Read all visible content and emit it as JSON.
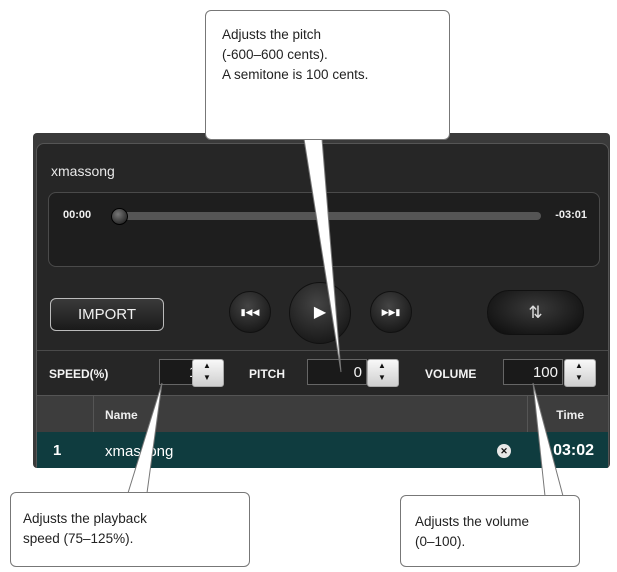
{
  "player": {
    "song_title": "xmassong",
    "time_elapsed": "00:00",
    "time_remaining": "-03:01",
    "progress": 0.0,
    "import_label": "IMPORT",
    "prev_icon": "skip-previous-icon",
    "play_icon": "play-icon",
    "next_icon": "skip-next-icon",
    "loop_icon": "repeat-icon"
  },
  "controls": {
    "speed_label": "SPEED(%)",
    "speed_value": "100",
    "pitch_label": "PITCH",
    "pitch_value": "0",
    "volume_label": "VOLUME",
    "volume_value": "100"
  },
  "list": {
    "headers": {
      "name": "Name",
      "time": "Time"
    },
    "rows": [
      {
        "num": "1",
        "name": "xmassong",
        "time": "03:02"
      }
    ]
  },
  "callouts": {
    "pitch": [
      "Adjusts the pitch",
      "(-600–600 cents).",
      "A semitone is 100 cents."
    ],
    "speed": [
      "Adjusts the playback",
      "speed (75–125%)."
    ],
    "volume": [
      "Adjusts the volume",
      "(0–100)."
    ]
  },
  "colors": {
    "panel": "#262626",
    "row_selected": "#0f3c3f",
    "callout_border": "#777777"
  }
}
